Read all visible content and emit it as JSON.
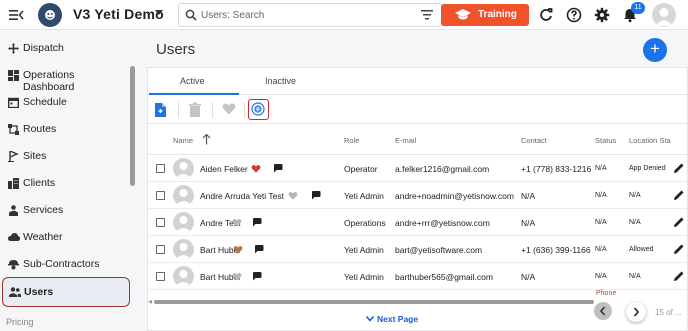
{
  "app": {
    "title": "V3 Yeti Demo",
    "search_placeholder": "Users: Search",
    "training_label": "Training",
    "notification_count": "11",
    "accent": "#1a73e8",
    "training_color": "#f0522c"
  },
  "sidebar": {
    "items": [
      {
        "label": "Dispatch",
        "icon": "dispatch-icon"
      },
      {
        "label": "Operations Dashboard",
        "icon": "dashboard-icon"
      },
      {
        "label": "Schedule",
        "icon": "calendar-icon"
      },
      {
        "label": "Routes",
        "icon": "routes-icon"
      },
      {
        "label": "Sites",
        "icon": "sites-icon"
      },
      {
        "label": "Clients",
        "icon": "clients-icon"
      },
      {
        "label": "Services",
        "icon": "services-icon"
      },
      {
        "label": "Weather",
        "icon": "cloud-icon"
      },
      {
        "label": "Sub-Contractors",
        "icon": "subcontractor-icon"
      },
      {
        "label": "Users",
        "icon": "users-icon",
        "active": true
      }
    ],
    "section_label": "Pricing"
  },
  "page": {
    "title": "Users",
    "tabs": [
      "Active",
      "Inactive"
    ],
    "active_tab": "Active"
  },
  "table": {
    "columns": {
      "name": "Name",
      "role": "Role",
      "email": "E-mail",
      "contact": "Contact",
      "status": "Status",
      "location_status": "Location Sta"
    },
    "rows": [
      {
        "name": "Aiden Felker",
        "heart": "red",
        "role": "Operator",
        "email": "a.felker1216@gmail.com",
        "contact": "+1 (778) 833-1216",
        "status": "N/A",
        "location": "App Denied"
      },
      {
        "name": "Andre Arruda Yeti Test",
        "heart": "gray",
        "role": "Yeti Admin",
        "email": "andre+noadmin@yetisnow.com",
        "contact": "N/A",
        "status": "N/A",
        "location": "N/A"
      },
      {
        "name": "Andre Test",
        "heart": "gray",
        "role": "Operations",
        "email": "andre+rrr@yetisnow.com",
        "contact": "N/A",
        "status": "N/A",
        "location": "N/A"
      },
      {
        "name": "Bart Huber",
        "heart": "brown",
        "role": "Yeti Admin",
        "email": "bart@yetisoftware.com",
        "contact": "+1 (636) 399-1166",
        "status": "N/A",
        "location": "Allowed"
      },
      {
        "name": "Bart Huber",
        "heart": "gray",
        "role": "Yeti Admin",
        "email": "barthuber565@gmail.com",
        "contact": "N/A",
        "status": "N/A",
        "location": "N/A"
      }
    ],
    "clipped_label": "Phone",
    "page_count": "15 of ...",
    "next_page_label": "Next Page"
  }
}
